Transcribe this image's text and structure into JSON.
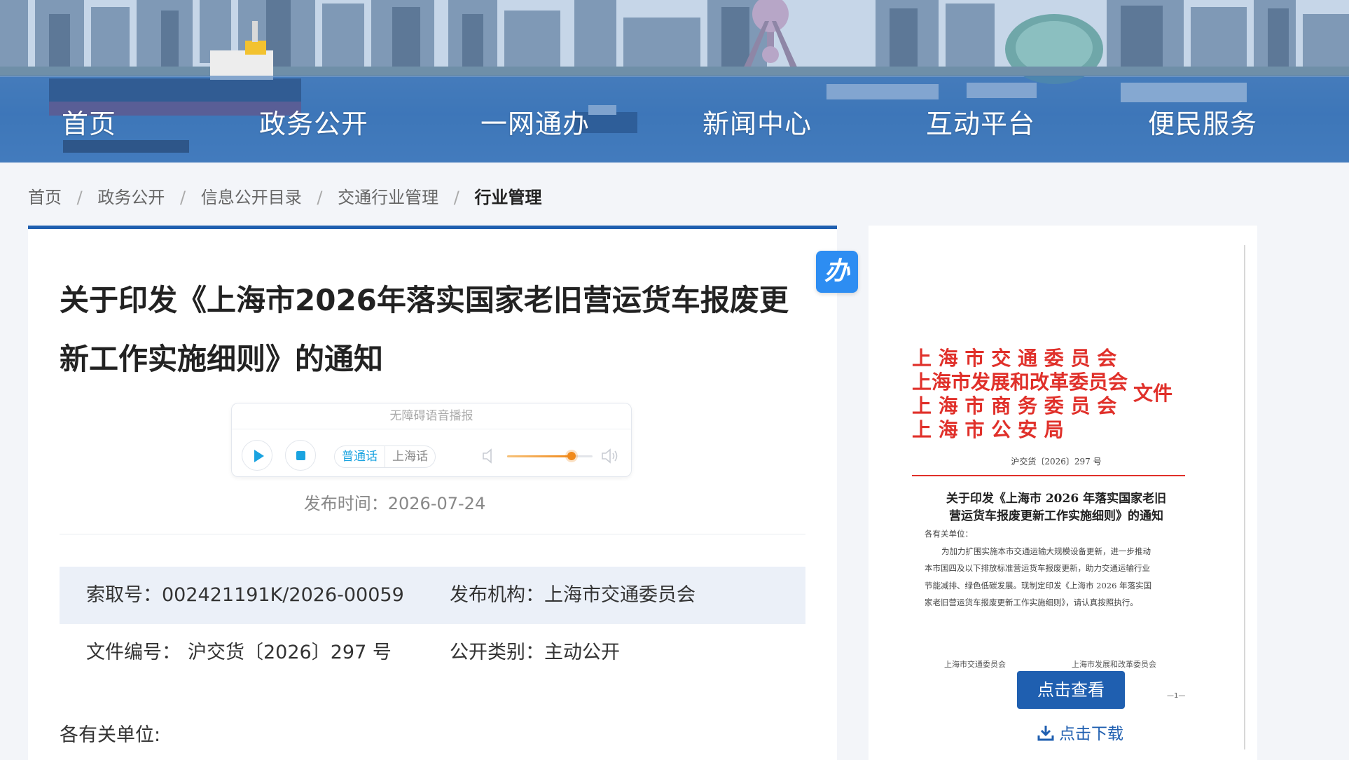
{
  "nav": {
    "items": [
      "首页",
      "政务公开",
      "一网通办",
      "新闻中心",
      "互动平台",
      "便民服务"
    ]
  },
  "breadcrumb": [
    "首页",
    "政务公开",
    "信息公开目录",
    "交通行业管理",
    "行业管理"
  ],
  "article": {
    "title": "关于印发《上海市2026年落实国家老旧营运货车报废更新工作实施细则》的通知",
    "audio": {
      "title": "无障碍语音播报",
      "dialects": [
        "普通话",
        "上海话"
      ],
      "volume_percent": 75
    },
    "publish_date": "发布时间：2026-07-24",
    "meta": {
      "index_label": "索取号：",
      "index_value": "002421191K/2026-00059",
      "issuer_label": "发布机构：",
      "issuer_value": "上海市交通委员会",
      "docno_label": "文件编号：",
      "docno_value": "沪交货〔2026〕297 号",
      "category_label": "公开类别：",
      "category_value": "主动公开"
    },
    "greeting": "各有关单位:"
  },
  "badge": "办",
  "preview": {
    "orgs": [
      "上 海 市 交 通 委 员 会",
      "上海市发展和改革委员会",
      "上 海 市 商 务 委 员 会",
      "上  海  市  公  安  局"
    ],
    "org_suffix": "文件",
    "doc_number": "沪交货〔2026〕297 号",
    "doc_title_1": "关于印发《上海市 2026 年落实国家老旧",
    "doc_title_2": "营运货车报废更新工作实施细则》的通知",
    "body_greeting": "各有关单位：",
    "body_lines": [
      "为加力扩围实施本市交通运输大规模设备更新，进一步推动",
      "本市国四及以下排放标准营运货车报废更新，助力交通运输行业",
      "节能减排、绿色低碳发展。现制定印发《上海市 2026 年落实国",
      "家老旧营运货车报废更新工作实施细则》，请认真按照执行。"
    ],
    "sign_left": "上海市交通委员会",
    "sign_right": "上海市发展和改革委员会",
    "page_mark": "—1—",
    "view_label": "点击查看",
    "download_label": "点击下载"
  },
  "colors": {
    "brand_blue": "#1f5fb0",
    "red_header": "#e0302a",
    "badge_blue": "#2d8df2",
    "audio_accent": "#1aa3e0",
    "volume_orange": "#f08a1c"
  },
  "icons": [
    "play-icon",
    "stop-icon",
    "volume-low-icon",
    "volume-high-icon",
    "download-icon"
  ]
}
